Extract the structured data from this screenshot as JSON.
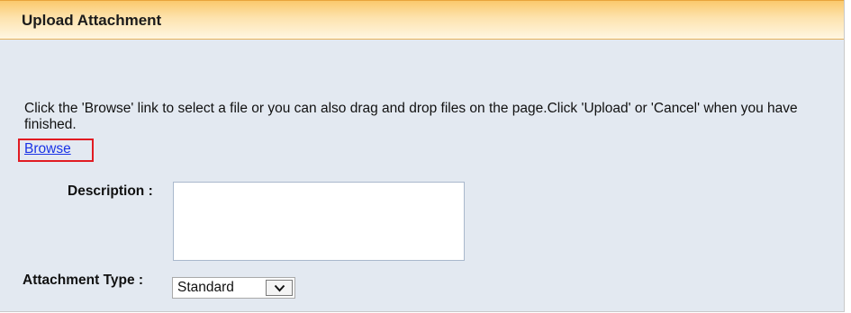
{
  "header": {
    "title": "Upload Attachment"
  },
  "instructions": {
    "text": "Click the 'Browse' link to select a file or you can also drag and drop files on the page.Click 'Upload' or 'Cancel' when you have finished."
  },
  "browse": {
    "label": "Browse",
    "highlight_color": "#e11b22"
  },
  "form": {
    "description": {
      "label": "Description :",
      "value": ""
    },
    "attachment_type": {
      "label": "Attachment Type :",
      "selected": "Standard"
    }
  },
  "colors": {
    "header_gradient_top": "#fbc96d",
    "panel_background": "#e3e9f1",
    "link": "#1a33e6"
  },
  "icons": {
    "dropdown": "chevron-down-icon"
  }
}
